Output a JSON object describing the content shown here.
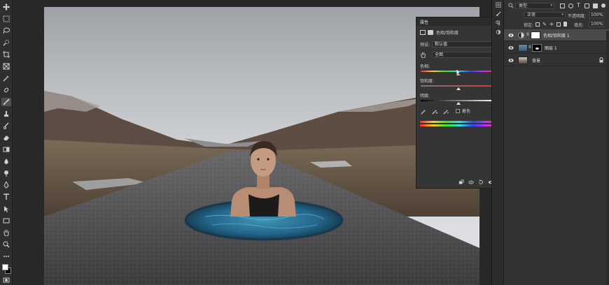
{
  "toolbar": {
    "tools": [
      "move-icon",
      "marquee-icon",
      "lasso-icon",
      "quick-select-icon",
      "crop-icon",
      "frame-icon",
      "eyedropper-icon",
      "healing-icon",
      "brush-icon",
      "stamp-icon",
      "history-brush-icon",
      "eraser-icon",
      "gradient-icon",
      "blur-icon",
      "dodge-icon",
      "pen-icon",
      "type-icon",
      "path-select-icon",
      "rectangle-icon",
      "hand-icon",
      "zoom-icon",
      "more-tools-icon"
    ],
    "active_tool": "brush-icon",
    "foreground_color": "#ffffff",
    "background_color": "#000000"
  },
  "properties": {
    "title": "属性",
    "adjustment_name": "色相/饱和度",
    "preset_label": "预设:",
    "preset_value": "默认值",
    "channel_value": "全图",
    "hue_label": "色相:",
    "hue_value": "0",
    "saturation_label": "饱和度:",
    "saturation_value": "0",
    "lightness_label": "明度:",
    "lightness_value": "0",
    "colorize_label": "着色",
    "hue_slider_position": 0.5,
    "saturation_slider_position": 0.5,
    "lightness_slider_position": 0.5
  },
  "layers": {
    "filter_label": "类型",
    "blend_mode": "正常",
    "opacity_label": "不透明度:",
    "opacity_value": "100%",
    "lock_label": "锁定:",
    "fill_label": "填充:",
    "fill_value": "100%",
    "items": [
      {
        "name": "色相/饱和度 1",
        "selected": true
      },
      {
        "name": "图层 1",
        "selected": false
      },
      {
        "name": "背景",
        "selected": false
      }
    ]
  },
  "colors": {
    "panel_bg": "#353535",
    "app_bg": "#262626",
    "selected_layer": "#4a4a4a",
    "sky": "#cfd2d6",
    "road": "#4b4b4c",
    "water": "#2f7b9b"
  }
}
